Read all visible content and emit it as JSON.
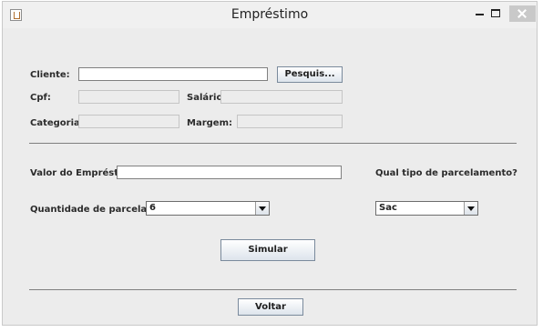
{
  "window": {
    "title": "Empréstimo"
  },
  "client": {
    "cliente_label": "Cliente:",
    "cliente_value": "",
    "search_button": "Pesquis...",
    "cpf_label": "Cpf:",
    "salario_label": "Salário:",
    "categoria_label": "Categoria:",
    "margem_label": "Margem:"
  },
  "loan": {
    "valor_label": "Valor do Empréstim...",
    "valor_value": "",
    "tipo_label": "Qual tipo de parcelamento?",
    "parcelas_label": "Quantidade de parcelas:",
    "parcelas_selected": "6",
    "tipo_selected": "Sac"
  },
  "actions": {
    "simular_button": "Simular",
    "voltar_button": "Voltar"
  }
}
